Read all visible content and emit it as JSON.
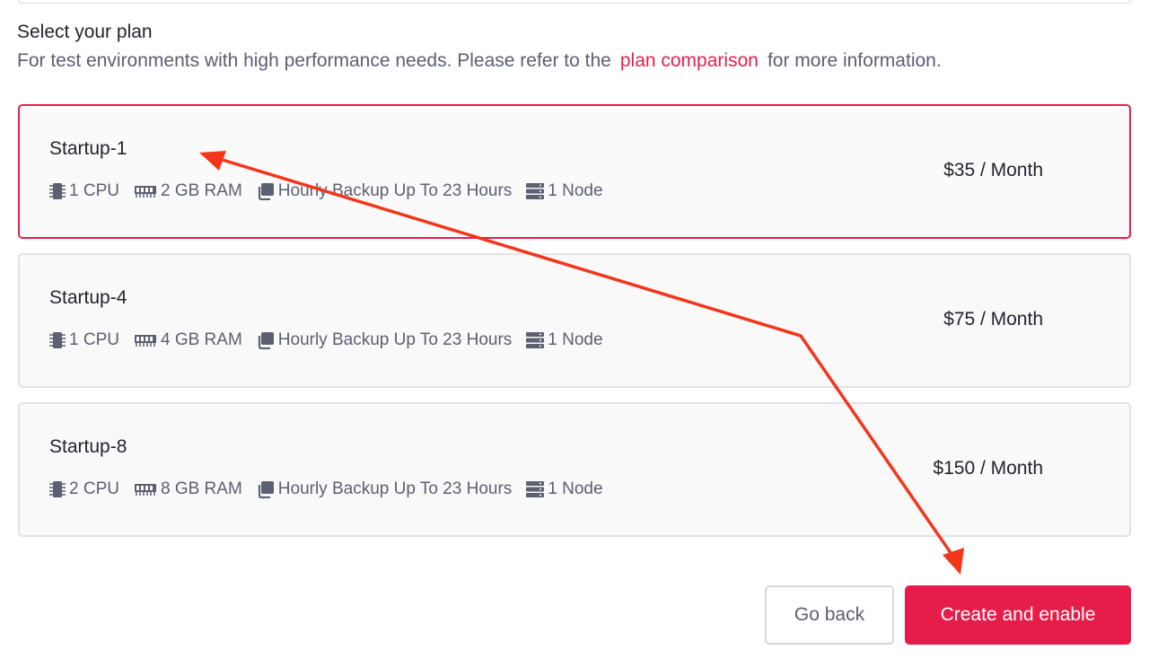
{
  "heading": "Select your plan",
  "subtext": {
    "before": "For test environments with high performance needs. Please refer to the",
    "link": "plan comparison",
    "after": "for more information."
  },
  "plans": [
    {
      "name": "Startup-1",
      "cpu": "1 CPU",
      "ram": "2 GB RAM",
      "backup": "Hourly Backup Up To 23 Hours",
      "nodes": "1 Node",
      "price": "$35 / Month",
      "selected": true
    },
    {
      "name": "Startup-4",
      "cpu": "1 CPU",
      "ram": "4 GB RAM",
      "backup": "Hourly Backup Up To 23 Hours",
      "nodes": "1 Node",
      "price": "$75 / Month",
      "selected": false
    },
    {
      "name": "Startup-8",
      "cpu": "2 CPU",
      "ram": "8 GB RAM",
      "backup": "Hourly Backup Up To 23 Hours",
      "nodes": "1 Node",
      "price": "$150 / Month",
      "selected": false
    }
  ],
  "buttons": {
    "back": "Go back",
    "create": "Create and enable"
  },
  "icons": {
    "cpu": "cpu-chip-icon",
    "ram": "memory-icon",
    "backup": "backup-copy-icon",
    "nodes": "server-icon"
  },
  "colors": {
    "accent": "#e61c4a",
    "annotation_arrow": "#f2361c"
  }
}
